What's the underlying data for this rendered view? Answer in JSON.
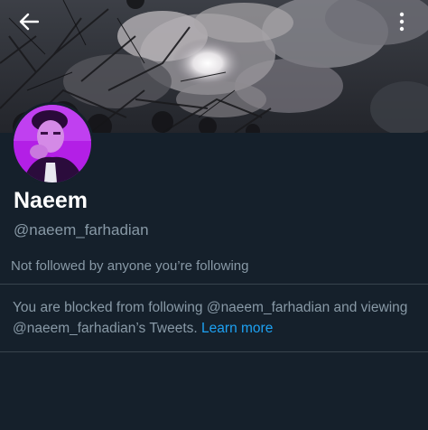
{
  "header": {
    "back_icon": "arrow-left-icon",
    "more_icon": "more-vertical-icon"
  },
  "profile": {
    "display_name": "Naeem",
    "handle": "@naeem_farhadian",
    "avatar_accent": "#b020e0"
  },
  "followers_note": "Not followed by anyone you’re following",
  "blocked_notice": {
    "text": "You are blocked from following @naeem_farhadian and viewing @naeem_farhadian’s Tweets.",
    "link_label": "Learn more"
  },
  "colors": {
    "background": "#15202b",
    "secondary_text": "#8899a6",
    "link": "#1da1f2",
    "divider": "#38444d"
  }
}
